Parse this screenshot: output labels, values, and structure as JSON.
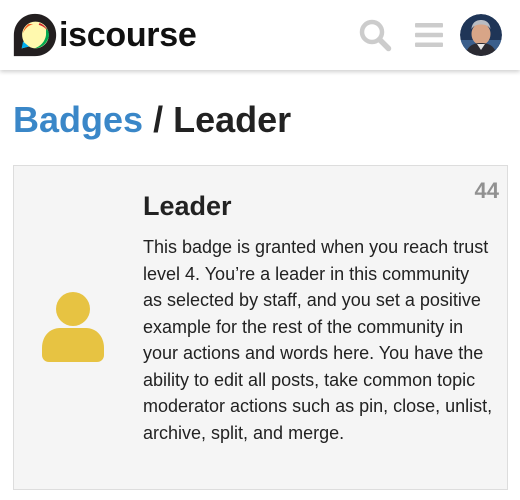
{
  "header": {
    "logo_text": "iscourse",
    "logo_alt": "Discourse",
    "icons": [
      "search-icon",
      "hamburger-menu-icon",
      "user-avatar"
    ]
  },
  "breadcrumb": {
    "parent": "Badges",
    "separator": "/",
    "current": "Leader"
  },
  "badge": {
    "name": "Leader",
    "grant_count": "44",
    "icon": "user-icon",
    "icon_color": "#e7c342",
    "description": "This badge is granted when you reach trust level 4. You’re a leader in this community as selected by staff, and you set a positive example for the rest of the community in your actions and words here. You have the ability to edit all posts, take common topic moderator actions such as pin, close, unlist, archive, split, and merge."
  },
  "colors": {
    "link": "#3a87c8",
    "text": "#222222",
    "muted": "#919191",
    "card_background": "#f5f5f5",
    "header_icon": "#cccccc"
  }
}
